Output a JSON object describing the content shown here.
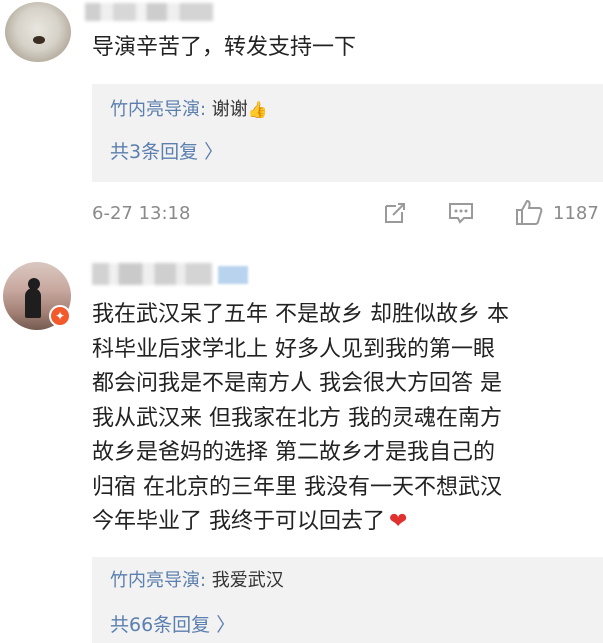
{
  "comment1": {
    "text": "导演辛苦了，转发支持一下",
    "reply": {
      "author": "竹内亮导演:",
      "text": " 谢谢",
      "emoji": "👍"
    },
    "more_replies": "共3条回复 〉",
    "timestamp": "6-27 13:18",
    "like_count": "1187"
  },
  "comment2": {
    "lines": [
      "我在武汉呆了五年 不是故乡 却胜似故乡 本",
      "科毕业后求学北上 好多人见到我的第一眼",
      "都会问我是不是南方人 我会很大方回答 是",
      "我从武汉来 但我家在北方 我的灵魂在南方",
      "故乡是爸妈的选择 第二故乡才是我自己的",
      "归宿 在北京的三年里 我没有一天不想武汉",
      "今年毕业了 我终于可以回去了"
    ],
    "heart": "❤",
    "reply": {
      "author": "竹内亮导演:",
      "text": " 我爱武汉"
    },
    "more_replies": "共66条回复 〉"
  },
  "icons": {
    "share": "share-icon",
    "comment": "comment-icon",
    "like": "thumbs-up-icon"
  },
  "colors": {
    "link": "#5b7fae",
    "reply_bg": "#f2f2f2",
    "heart": "#e0312f",
    "vip_badge": "#f25a2c"
  }
}
